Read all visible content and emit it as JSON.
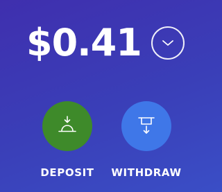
{
  "balance": {
    "amount": "$0.41",
    "toggle_icon": "chevron-down-icon"
  },
  "actions": [
    {
      "label": "DEPOSIT",
      "icon": "deposit-icon",
      "color": "#3e8a2a"
    },
    {
      "label": "WITHDRAW",
      "icon": "withdraw-icon",
      "color": "#3f77e8"
    }
  ],
  "colors": {
    "background_start": "#3f2fae",
    "background_end": "#3a4ec6"
  }
}
